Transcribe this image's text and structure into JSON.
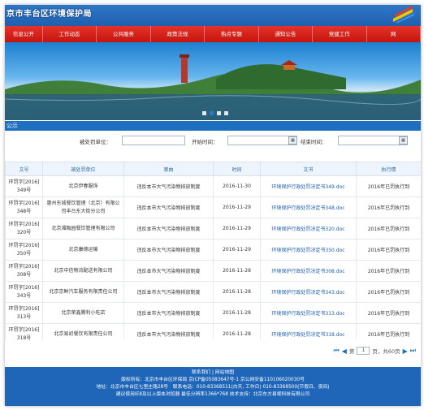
{
  "header": {
    "title": "京市丰台区环境保护局"
  },
  "nav": [
    "信息公开",
    "工作动态",
    "公共服务",
    "政策法规",
    "热点专题",
    "通知公告",
    "党建工作",
    "网"
  ],
  "banner": {
    "dots": 4,
    "active_dot": 1
  },
  "section": {
    "label": "公示"
  },
  "search": {
    "unit_label": "被处罚单位：",
    "start_label": "开始时间：",
    "end_label": "结束时间："
  },
  "table": {
    "headers": [
      "文号",
      "被处罚单位",
      "案由",
      "时间",
      "文书",
      "执行情"
    ],
    "rows": [
      {
        "no": "环罚字[2016] 349号",
        "unit": "北京伊春服饰",
        "reason": "违反本市大气污染物排放制度",
        "date": "2016-11-30",
        "doc": "环境保护行政处罚决定书349.doc",
        "status": "2016年已罚执行到"
      },
      {
        "no": "环罚字[2016] 348号",
        "unit": "惠州东城餐饮管理（北京）有限公司丰台东大街分公司",
        "reason": "违反本市大气污染物排放制度",
        "date": "2016-11-29",
        "doc": "环境保护行政处罚决定书348.doc",
        "status": "2016年已罚执行到"
      },
      {
        "no": "环罚字[2016] 320号",
        "unit": "北京湘融园餐饮管理有限公司",
        "reason": "违反本市大气污染物排放制度",
        "date": "2016-11-29",
        "doc": "环境保护行政处罚决定书320.doc",
        "status": "2016年已罚执行到"
      },
      {
        "no": "环罚字[2016] 350号",
        "unit": "北京康德运输",
        "reason": "违反本市大气污染物排放制度",
        "date": "2016-11-29",
        "doc": "环境保护行政处罚决定书350.doc",
        "status": "2016年已罚执行到"
      },
      {
        "no": "环罚字[2016] 308号",
        "unit": "北京中信物流配送有限公司",
        "reason": "违反本市大气污染物排放制度",
        "date": "2016-11-28",
        "doc": "环境保护行政处罚决定书308.doc",
        "status": "2016年已罚执行到"
      },
      {
        "no": "环罚字[2016] 343号",
        "unit": "北京京鲜汽车服务有限责任公司",
        "reason": "违反本市大气污染物排放制度",
        "date": "2016-11-28",
        "doc": "环境保护行政处罚决定书343.doc",
        "status": "2016年已罚执行到"
      },
      {
        "no": "环罚字[2016] 313号",
        "unit": "北京荣鑫腾利小吃店",
        "reason": "违反本市大气污染物排放制度",
        "date": "2016-11-28",
        "doc": "环境保护行政处罚决定书313.doc",
        "status": "2016年已罚执行到"
      },
      {
        "no": "环罚字[2016] 318号",
        "unit": "北京易初餐饮有限责任公司",
        "reason": "违反本市大气污染物排放制度",
        "date": "2016-11-28",
        "doc": "环境保护行政处罚决定书318.doc",
        "status": "2016年已罚执行到"
      }
    ]
  },
  "pager": {
    "page_prefix": "第",
    "page": "1",
    "page_suffix": "页，共60页"
  },
  "footer": {
    "links": "联系我们 | 网站地图",
    "line1": "版权所有：北京市丰台区环保局 京ICP备05083647号-1 京公网安备110106020030号",
    "line2": "地址：北京市丰台区七里庄路28号　联系电话：010-83368511(白天, 工作日) 010-83368500(节假日、夜间)",
    "line3": "建议使用IE8及以上版本浏览器 最佳分辨率1366*768 技术支持：北京东方易视科技有限公司"
  }
}
